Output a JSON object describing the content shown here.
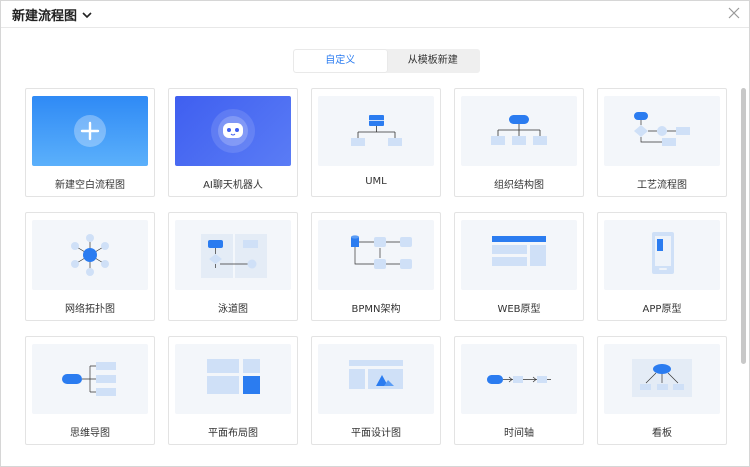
{
  "header": {
    "title": "新建流程图"
  },
  "tabs": [
    {
      "label": "自定义"
    },
    {
      "label": "从模板新建"
    }
  ],
  "templates": [
    {
      "label": "新建空白流程图"
    },
    {
      "label": "AI聊天机器人"
    },
    {
      "label": "UML"
    },
    {
      "label": "组织结构图"
    },
    {
      "label": "工艺流程图"
    },
    {
      "label": "网络拓扑图"
    },
    {
      "label": "泳道图"
    },
    {
      "label": "BPMN架构"
    },
    {
      "label": "WEB原型"
    },
    {
      "label": "APP原型"
    },
    {
      "label": "思维导图"
    },
    {
      "label": "平面布局图"
    },
    {
      "label": "平面设计图"
    },
    {
      "label": "时间轴"
    },
    {
      "label": "看板"
    }
  ],
  "colors": {
    "accent": "#2b7cf0",
    "light_blue": "#cfe0f7",
    "thumb_bg": "#f3f6fa"
  }
}
